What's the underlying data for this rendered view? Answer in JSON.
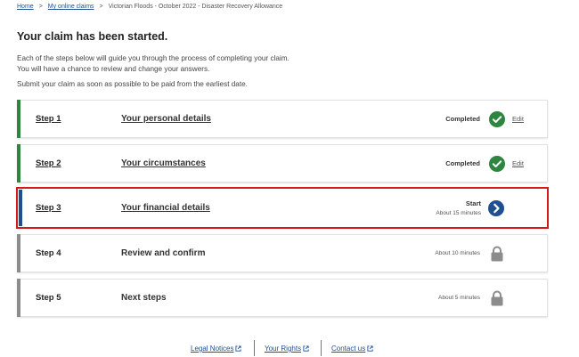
{
  "breadcrumb": {
    "home": "Home",
    "my_claims": "My online claims",
    "current": "Victorian Floods - October 2022 - Disaster Recovery Allowance",
    "separator": ">"
  },
  "page_title": "Your claim has been started.",
  "intro": {
    "line1": "Each of the steps below will guide you through the process of completing your claim.",
    "line2": "You will have a chance to review and change your answers.",
    "line3": "Submit your claim as soon as possible to be paid from the earliest date."
  },
  "steps": [
    {
      "number": "Step 1",
      "name": "Your personal details",
      "status": "Completed",
      "action": "Edit",
      "icon": "check-circle-icon",
      "bar_color": "#2e8540"
    },
    {
      "number": "Step 2",
      "name": "Your circumstances",
      "status": "Completed",
      "action": "Edit",
      "icon": "check-circle-icon",
      "bar_color": "#2e8540"
    },
    {
      "number": "Step 3",
      "name": "Your financial details",
      "status": "Start",
      "time": "About 15 minutes",
      "icon": "chevron-right-circle-icon",
      "bar_color": "#1d4f91"
    },
    {
      "number": "Step 4",
      "name": "Review and confirm",
      "time": "About 10 minutes",
      "icon": "lock-icon",
      "bar_color": "#8c8c8c"
    },
    {
      "number": "Step 5",
      "name": "Next steps",
      "time": "About 5 minutes",
      "icon": "lock-icon",
      "bar_color": "#8c8c8c"
    }
  ],
  "footer": {
    "legal": "Legal Notices",
    "rights": "Your Rights",
    "contact": "Contact us",
    "external_icon": "external-link-icon"
  },
  "colors": {
    "completed_green": "#2e8540",
    "link_blue": "#1d4f91",
    "locked_gray": "#8c8c8c",
    "highlight_red": "#d21a1a"
  }
}
